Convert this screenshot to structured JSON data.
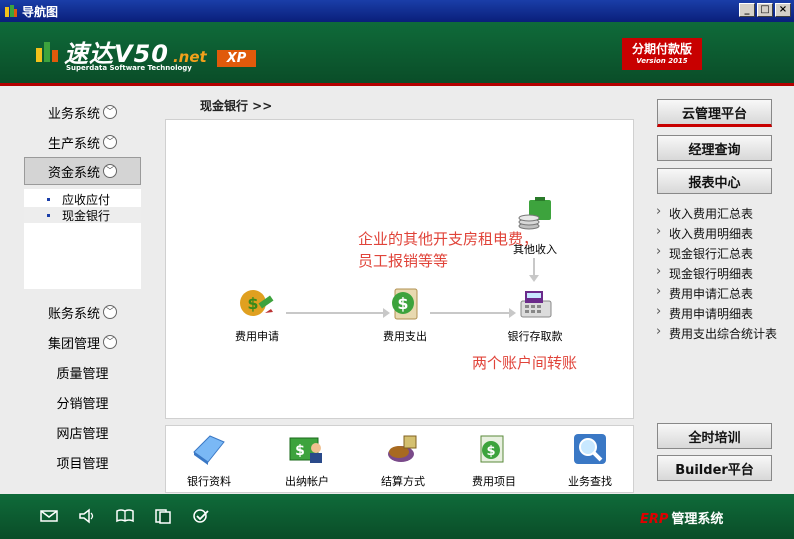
{
  "window": {
    "title": "导航图",
    "min": "_",
    "max": "□",
    "close": "×"
  },
  "header": {
    "brand": "速达V50",
    "net": ".net",
    "xp": "XP",
    "subtitle": "Superdata Software Technology",
    "edition": "分期付款版",
    "version": "Version 2015"
  },
  "sidebar": {
    "items": [
      {
        "label": "业务系统"
      },
      {
        "label": "生产系统"
      },
      {
        "label": "资金系统"
      },
      {
        "label": "账务系统"
      },
      {
        "label": "集团管理"
      },
      {
        "label": "质量管理"
      },
      {
        "label": "分销管理"
      },
      {
        "label": "网店管理"
      },
      {
        "label": "项目管理"
      }
    ],
    "submenu": [
      {
        "label": "应收应付"
      },
      {
        "label": "现金银行"
      }
    ]
  },
  "breadcrumb": "现金银行  >>",
  "flow": {
    "nodes": [
      {
        "label": "费用申请"
      },
      {
        "label": "费用支出"
      },
      {
        "label": "银行存取款"
      },
      {
        "label": "其他收入"
      }
    ],
    "note1": "企业的其他开支房租电费，员工报销等等",
    "note2": "两个账户间转账"
  },
  "tools": [
    {
      "label": "银行资料"
    },
    {
      "label": "出纳帐户"
    },
    {
      "label": "结算方式"
    },
    {
      "label": "费用项目"
    },
    {
      "label": "业务查找"
    }
  ],
  "right": {
    "cloud": "云管理平台",
    "manager": "经理查询",
    "report": "报表中心",
    "reports": [
      "收入费用汇总表",
      "收入费用明细表",
      "现金银行汇总表",
      "现金银行明细表",
      "费用申请汇总表",
      "费用申请明细表",
      "费用支出综合统计表"
    ],
    "training": "全时培训",
    "builder": "Builder平台"
  },
  "footer": {
    "erp": "ERP",
    "system": "管理系统"
  }
}
